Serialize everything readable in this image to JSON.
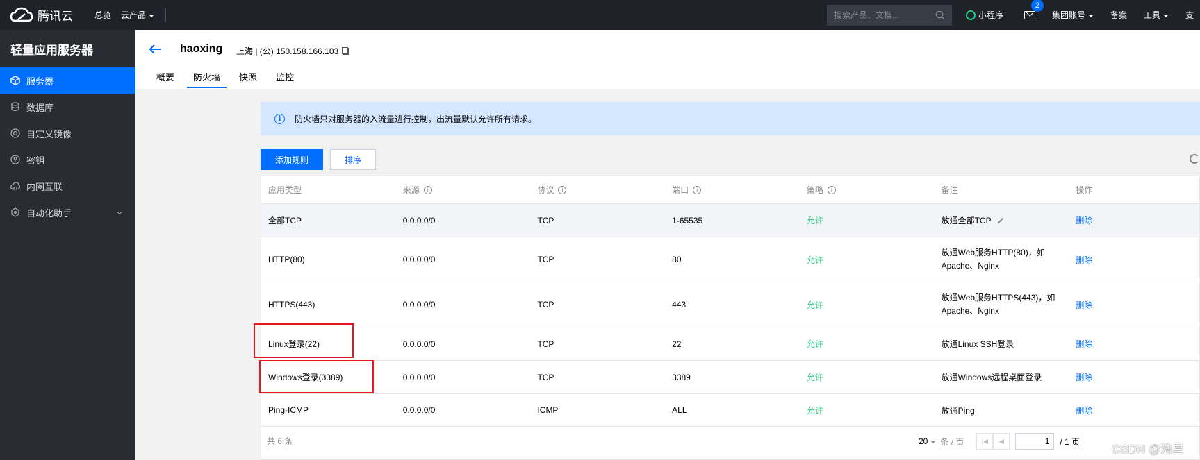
{
  "topbar": {
    "logo_text": "腾讯云",
    "nav": [
      "总览",
      "云产品"
    ],
    "search_placeholder": "搜索产品、文档...",
    "mini_program": "小程序",
    "mail_badge": "2",
    "account": "集团账号",
    "beian": "备案",
    "tools": "工具",
    "more": "支"
  },
  "sidebar": {
    "title": "轻量应用服务器",
    "items": [
      {
        "label": "服务器",
        "icon": "cube-icon",
        "active": true
      },
      {
        "label": "数据库",
        "icon": "database-icon"
      },
      {
        "label": "自定义镜像",
        "icon": "disc-icon"
      },
      {
        "label": "密钥",
        "icon": "key-icon"
      },
      {
        "label": "内网互联",
        "icon": "cloud-link-icon"
      },
      {
        "label": "自动化助手",
        "icon": "robot-icon"
      }
    ]
  },
  "header": {
    "instance_name": "haoxing",
    "location": "上海 | (公) 150.158.166.103",
    "tabs": [
      "概要",
      "防火墙",
      "快照",
      "监控"
    ],
    "active_tab": "防火墙"
  },
  "notice": "防火墙只对服务器的入流量进行控制，出流量默认允许所有请求。",
  "buttons": {
    "add_rule": "添加规则",
    "sort": "排序"
  },
  "table": {
    "columns": [
      "应用类型",
      "来源",
      "协议",
      "端口",
      "策略",
      "备注",
      "操作"
    ],
    "rows": [
      {
        "app": "全部TCP",
        "source": "0.0.0.0/0",
        "protocol": "TCP",
        "port": "1-65535",
        "policy": "允许",
        "remark_1": "放通全部TCP",
        "remark_2": "",
        "action": "删除"
      },
      {
        "app": "HTTP(80)",
        "source": "0.0.0.0/0",
        "protocol": "TCP",
        "port": "80",
        "policy": "允许",
        "remark_1": "放通Web服务HTTP(80)，如",
        "remark_2": "Apache、Nginx",
        "action": "删除"
      },
      {
        "app": "HTTPS(443)",
        "source": "0.0.0.0/0",
        "protocol": "TCP",
        "port": "443",
        "policy": "允许",
        "remark_1": "放通Web服务HTTPS(443)，如",
        "remark_2": "Apache、Nginx",
        "action": "删除"
      },
      {
        "app": "Linux登录(22)",
        "source": "0.0.0.0/0",
        "protocol": "TCP",
        "port": "22",
        "policy": "允许",
        "remark_1": "放通Linux SSH登录",
        "remark_2": "",
        "action": "删除"
      },
      {
        "app": "Windows登录(3389)",
        "source": "0.0.0.0/0",
        "protocol": "TCP",
        "port": "3389",
        "policy": "允许",
        "remark_1": "放通Windows远程桌面登录",
        "remark_2": "",
        "action": "删除"
      },
      {
        "app": "Ping-ICMP",
        "source": "0.0.0.0/0",
        "protocol": "ICMP",
        "port": "ALL",
        "policy": "允许",
        "remark_1": "放通Ping",
        "remark_2": "",
        "action": "删除"
      }
    ],
    "total": "共 6 条",
    "page_size": "20",
    "per_page_label": "条 / 页",
    "current_page": "1",
    "page_total": "/ 1 页"
  },
  "watermark": "CSDN @浩星"
}
